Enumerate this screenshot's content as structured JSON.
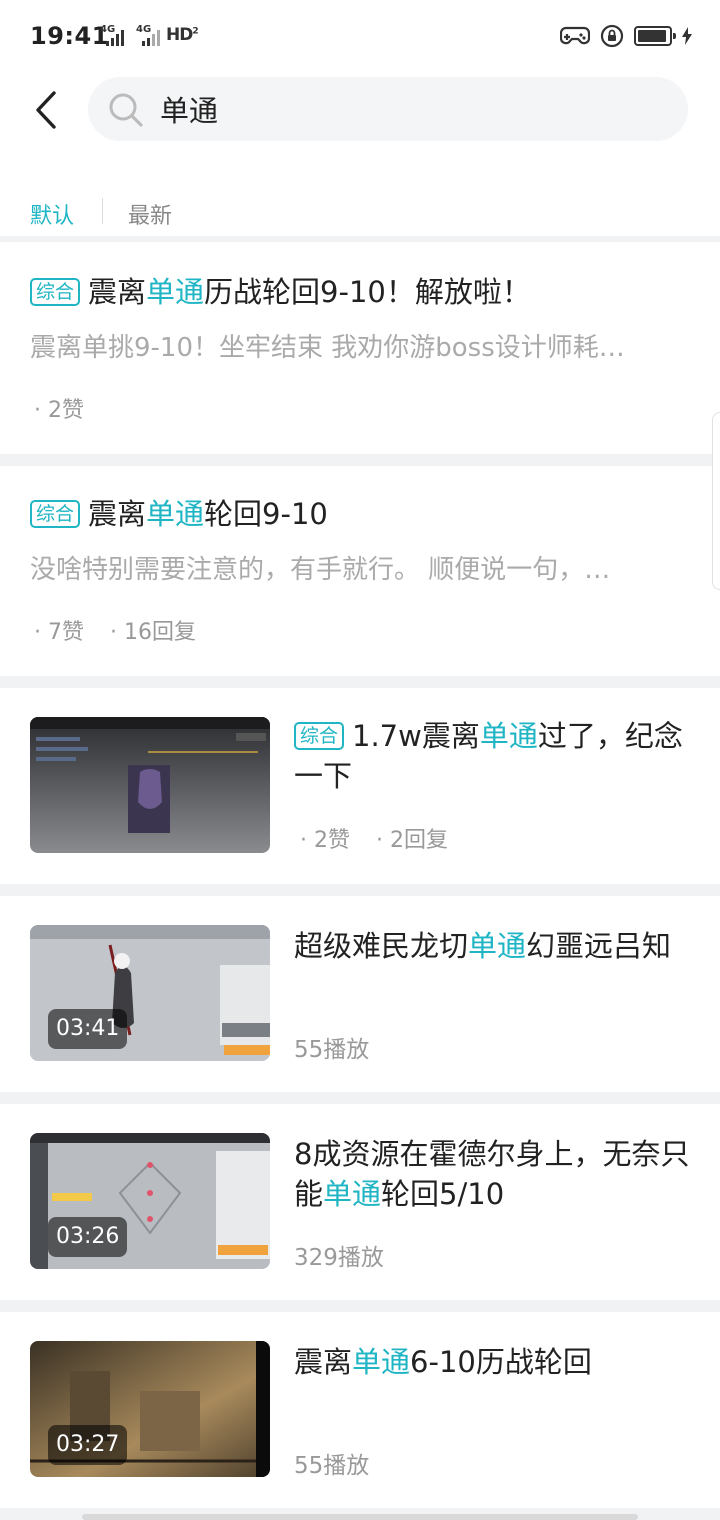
{
  "status_bar": {
    "time": "19:41",
    "network_label_1": "4G",
    "network_label_2": "4G",
    "hd_label": "HD",
    "hd_sub": "2"
  },
  "header": {
    "back_icon": "chevron-left-icon",
    "search_icon": "search-icon",
    "search_value": "单通"
  },
  "sort_tabs": [
    {
      "label": "默认",
      "active": true
    },
    {
      "label": "最新",
      "active": false
    }
  ],
  "posts": [
    {
      "tag": "综合",
      "title_pre": "震离",
      "title_hl": "单通",
      "title_post": "历战轮回9-10！解放啦！",
      "snippet": "震离单挑9-10！坐牢结束 我劝你游boss设计师耗…",
      "likes": "· 2赞"
    },
    {
      "tag": "综合",
      "title_pre": "震离",
      "title_hl": "单通",
      "title_post": "轮回9-10",
      "snippet": "没啥特别需要注意的，有手就行。 顺便说一句，…",
      "likes": "· 7赞",
      "replies": "· 16回复"
    },
    {
      "tag": "综合",
      "title_pre": "1.7w震离",
      "title_hl": "单通",
      "title_post": "过了，纪念一下",
      "likes": "· 2赞",
      "replies": "· 2回复",
      "thumb_icon": "game-screenshot-thumbnail"
    }
  ],
  "videos": [
    {
      "title_pre": "超级难民龙切",
      "title_hl": "单通",
      "title_post": "幻噩远吕知",
      "duration": "03:41",
      "plays": "55播放"
    },
    {
      "title_pre": "8成资源在霍德尔身上，无奈只能",
      "title_hl": "单通",
      "title_post": "轮回5/10",
      "duration": "03:26",
      "plays": "329播放"
    },
    {
      "title_pre": "震离",
      "title_hl": "单通",
      "title_post": "6-10历战轮回",
      "duration": "03:27",
      "plays": "55播放"
    }
  ],
  "colors": {
    "accent": "#1fb5c4",
    "gap": "#f1f2f4",
    "muted_text": "#999999"
  }
}
